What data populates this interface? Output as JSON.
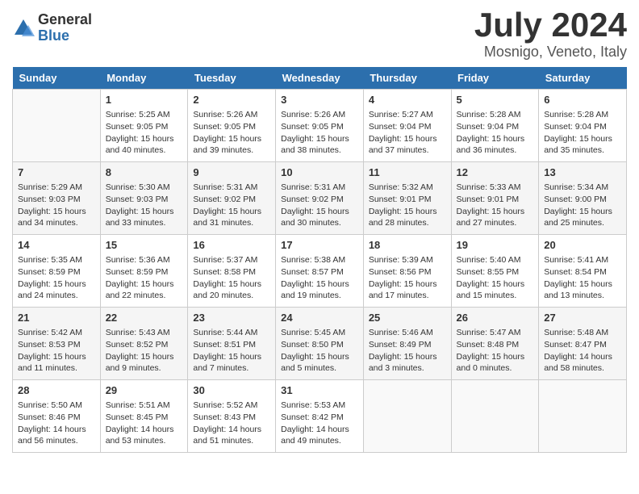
{
  "logo": {
    "general": "General",
    "blue": "Blue"
  },
  "title": "July 2024",
  "location": "Mosnigo, Veneto, Italy",
  "headers": [
    "Sunday",
    "Monday",
    "Tuesday",
    "Wednesday",
    "Thursday",
    "Friday",
    "Saturday"
  ],
  "weeks": [
    [
      {
        "day": "",
        "info": ""
      },
      {
        "day": "1",
        "info": "Sunrise: 5:25 AM\nSunset: 9:05 PM\nDaylight: 15 hours\nand 40 minutes."
      },
      {
        "day": "2",
        "info": "Sunrise: 5:26 AM\nSunset: 9:05 PM\nDaylight: 15 hours\nand 39 minutes."
      },
      {
        "day": "3",
        "info": "Sunrise: 5:26 AM\nSunset: 9:05 PM\nDaylight: 15 hours\nand 38 minutes."
      },
      {
        "day": "4",
        "info": "Sunrise: 5:27 AM\nSunset: 9:04 PM\nDaylight: 15 hours\nand 37 minutes."
      },
      {
        "day": "5",
        "info": "Sunrise: 5:28 AM\nSunset: 9:04 PM\nDaylight: 15 hours\nand 36 minutes."
      },
      {
        "day": "6",
        "info": "Sunrise: 5:28 AM\nSunset: 9:04 PM\nDaylight: 15 hours\nand 35 minutes."
      }
    ],
    [
      {
        "day": "7",
        "info": "Sunrise: 5:29 AM\nSunset: 9:03 PM\nDaylight: 15 hours\nand 34 minutes."
      },
      {
        "day": "8",
        "info": "Sunrise: 5:30 AM\nSunset: 9:03 PM\nDaylight: 15 hours\nand 33 minutes."
      },
      {
        "day": "9",
        "info": "Sunrise: 5:31 AM\nSunset: 9:02 PM\nDaylight: 15 hours\nand 31 minutes."
      },
      {
        "day": "10",
        "info": "Sunrise: 5:31 AM\nSunset: 9:02 PM\nDaylight: 15 hours\nand 30 minutes."
      },
      {
        "day": "11",
        "info": "Sunrise: 5:32 AM\nSunset: 9:01 PM\nDaylight: 15 hours\nand 28 minutes."
      },
      {
        "day": "12",
        "info": "Sunrise: 5:33 AM\nSunset: 9:01 PM\nDaylight: 15 hours\nand 27 minutes."
      },
      {
        "day": "13",
        "info": "Sunrise: 5:34 AM\nSunset: 9:00 PM\nDaylight: 15 hours\nand 25 minutes."
      }
    ],
    [
      {
        "day": "14",
        "info": "Sunrise: 5:35 AM\nSunset: 8:59 PM\nDaylight: 15 hours\nand 24 minutes."
      },
      {
        "day": "15",
        "info": "Sunrise: 5:36 AM\nSunset: 8:59 PM\nDaylight: 15 hours\nand 22 minutes."
      },
      {
        "day": "16",
        "info": "Sunrise: 5:37 AM\nSunset: 8:58 PM\nDaylight: 15 hours\nand 20 minutes."
      },
      {
        "day": "17",
        "info": "Sunrise: 5:38 AM\nSunset: 8:57 PM\nDaylight: 15 hours\nand 19 minutes."
      },
      {
        "day": "18",
        "info": "Sunrise: 5:39 AM\nSunset: 8:56 PM\nDaylight: 15 hours\nand 17 minutes."
      },
      {
        "day": "19",
        "info": "Sunrise: 5:40 AM\nSunset: 8:55 PM\nDaylight: 15 hours\nand 15 minutes."
      },
      {
        "day": "20",
        "info": "Sunrise: 5:41 AM\nSunset: 8:54 PM\nDaylight: 15 hours\nand 13 minutes."
      }
    ],
    [
      {
        "day": "21",
        "info": "Sunrise: 5:42 AM\nSunset: 8:53 PM\nDaylight: 15 hours\nand 11 minutes."
      },
      {
        "day": "22",
        "info": "Sunrise: 5:43 AM\nSunset: 8:52 PM\nDaylight: 15 hours\nand 9 minutes."
      },
      {
        "day": "23",
        "info": "Sunrise: 5:44 AM\nSunset: 8:51 PM\nDaylight: 15 hours\nand 7 minutes."
      },
      {
        "day": "24",
        "info": "Sunrise: 5:45 AM\nSunset: 8:50 PM\nDaylight: 15 hours\nand 5 minutes."
      },
      {
        "day": "25",
        "info": "Sunrise: 5:46 AM\nSunset: 8:49 PM\nDaylight: 15 hours\nand 3 minutes."
      },
      {
        "day": "26",
        "info": "Sunrise: 5:47 AM\nSunset: 8:48 PM\nDaylight: 15 hours\nand 0 minutes."
      },
      {
        "day": "27",
        "info": "Sunrise: 5:48 AM\nSunset: 8:47 PM\nDaylight: 14 hours\nand 58 minutes."
      }
    ],
    [
      {
        "day": "28",
        "info": "Sunrise: 5:50 AM\nSunset: 8:46 PM\nDaylight: 14 hours\nand 56 minutes."
      },
      {
        "day": "29",
        "info": "Sunrise: 5:51 AM\nSunset: 8:45 PM\nDaylight: 14 hours\nand 53 minutes."
      },
      {
        "day": "30",
        "info": "Sunrise: 5:52 AM\nSunset: 8:43 PM\nDaylight: 14 hours\nand 51 minutes."
      },
      {
        "day": "31",
        "info": "Sunrise: 5:53 AM\nSunset: 8:42 PM\nDaylight: 14 hours\nand 49 minutes."
      },
      {
        "day": "",
        "info": ""
      },
      {
        "day": "",
        "info": ""
      },
      {
        "day": "",
        "info": ""
      }
    ]
  ]
}
